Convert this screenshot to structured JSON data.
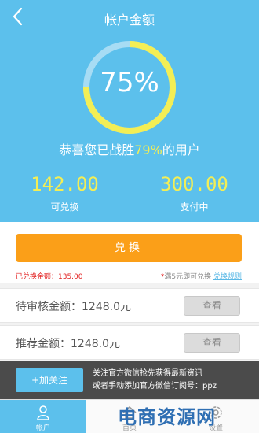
{
  "header": {
    "title": "帐户金额"
  },
  "progress": {
    "percent_text": "75%",
    "value": 0.75
  },
  "congrats": {
    "prefix": "恭喜您已战胜",
    "highlight": "79%",
    "suffix": "的用户"
  },
  "stats": [
    {
      "value": "142.00",
      "label": "可兑换"
    },
    {
      "value": "300.00",
      "label": "支付中"
    }
  ],
  "exchange": {
    "button_label": "兑换",
    "exchanged_text": "已兑换金额：135.00",
    "hint_star": "*",
    "hint_text": "满5元即可兑换",
    "rule_link": "兑换规则"
  },
  "rows": [
    {
      "label": "待审核金额：1248.0元",
      "button": "查看"
    },
    {
      "label": "推荐金额：1248.0元",
      "button": "查看"
    }
  ],
  "follow": {
    "button": "+加关注",
    "line1": "关注官方微信抢先获得最新资讯",
    "line2": "或者手动添加官方微信订阅号：ppz"
  },
  "nav": [
    {
      "label": "帐户",
      "icon": "user-icon",
      "active": true
    },
    {
      "label": "首页",
      "icon": "home-icon",
      "active": false
    },
    {
      "label": "设置",
      "icon": "gear-icon",
      "active": false
    }
  ],
  "watermark": "电商资源网",
  "colors": {
    "primary": "#5cc0ec",
    "accent_yellow": "#f3ee55",
    "orange": "#fb9f18",
    "red": "#e21e1e"
  }
}
